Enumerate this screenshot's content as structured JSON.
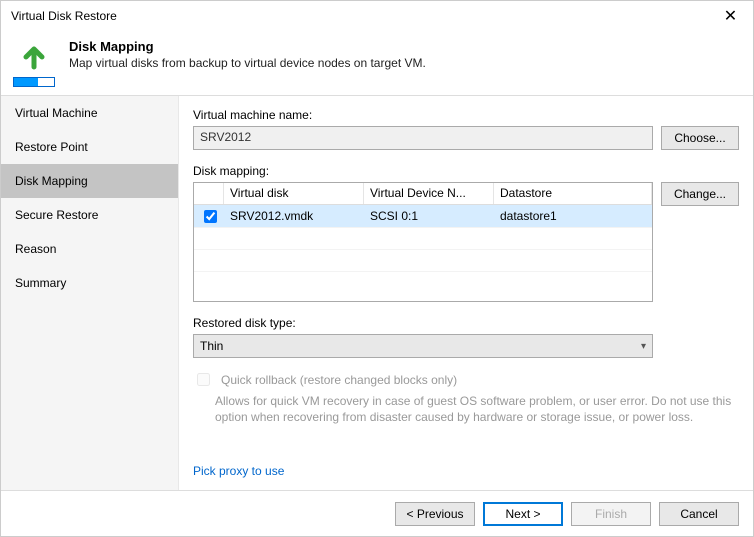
{
  "window": {
    "title": "Virtual Disk Restore"
  },
  "header": {
    "title": "Disk Mapping",
    "subtitle": "Map virtual disks from backup to virtual device nodes on target VM."
  },
  "sidebar": {
    "items": [
      {
        "label": "Virtual Machine"
      },
      {
        "label": "Restore Point"
      },
      {
        "label": "Disk Mapping",
        "active": true
      },
      {
        "label": "Secure Restore"
      },
      {
        "label": "Reason"
      },
      {
        "label": "Summary"
      }
    ]
  },
  "main": {
    "vm_name_label": "Virtual machine name:",
    "vm_name_value": "SRV2012",
    "choose_btn": "Choose...",
    "disk_mapping_label": "Disk mapping:",
    "change_btn": "Change...",
    "grid": {
      "headers": {
        "a": "Virtual disk",
        "b": "Virtual Device N...",
        "c": "Datastore"
      },
      "rows": [
        {
          "checked": true,
          "a": "SRV2012.vmdk",
          "b": "SCSI 0:1",
          "c": "datastore1"
        }
      ]
    },
    "disk_type_label": "Restored disk type:",
    "disk_type_value": "Thin",
    "quick_rollback_label": "Quick rollback (restore changed blocks only)",
    "quick_rollback_hint": "Allows for quick VM recovery in case of guest OS software problem, or user error. Do not use this option when recovering from disaster caused by hardware or storage issue, or power loss.",
    "proxy_link": "Pick proxy to use"
  },
  "footer": {
    "previous": "< Previous",
    "next": "Next >",
    "finish": "Finish",
    "cancel": "Cancel"
  }
}
